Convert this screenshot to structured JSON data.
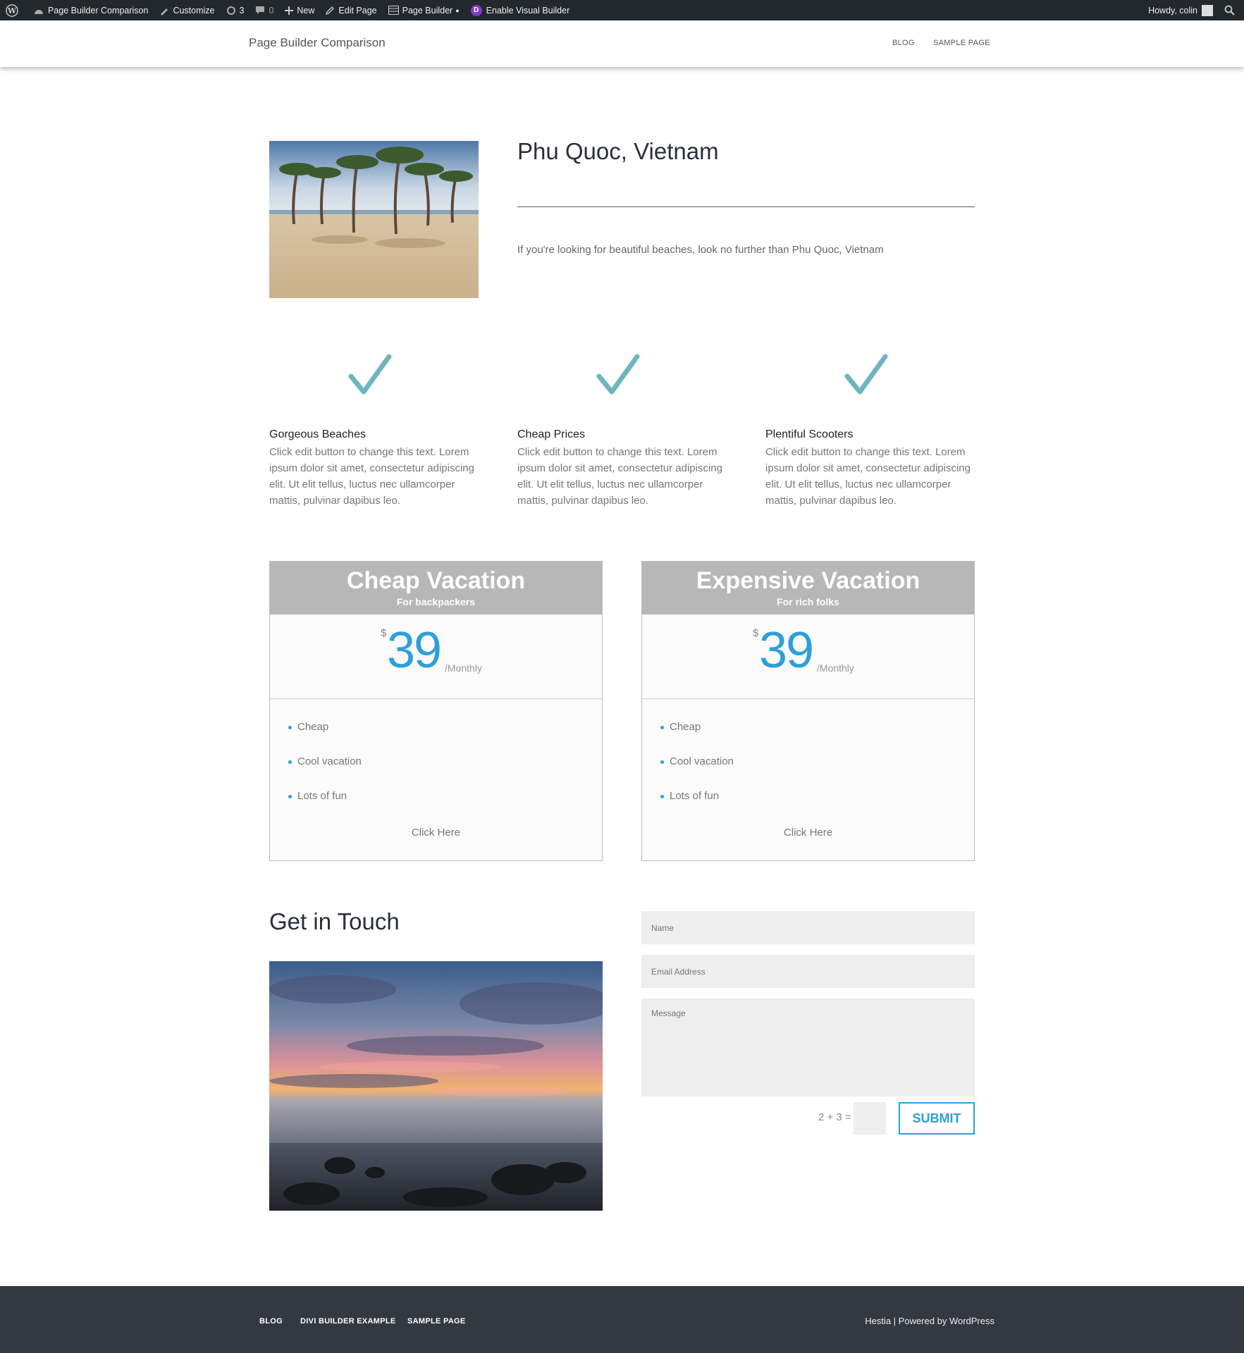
{
  "admin_bar": {
    "site_name": "Page Builder Comparison",
    "customize": "Customize",
    "updates_count": "3",
    "comments_count": "0",
    "new_label": "New",
    "edit_page": "Edit Page",
    "page_builder": "Page Builder",
    "visual_builder": "Enable Visual Builder",
    "divi_letter": "D",
    "greeting": "Howdy, colin"
  },
  "header": {
    "brand": "Page Builder Comparison",
    "nav": [
      "BLOG",
      "SAMPLE PAGE"
    ]
  },
  "intro": {
    "title": "Phu Quoc, Vietnam",
    "text": "If you're looking for beautiful beaches, look no further than Phu Quoc, Vietnam"
  },
  "features": [
    {
      "title": "Gorgeous Beaches",
      "text": "Click edit button to change this text. Lorem ipsum dolor sit amet, consectetur adipiscing elit. Ut elit tellus, luctus nec ullamcorper mattis, pulvinar dapibus leo.",
      "icon": "check-icon"
    },
    {
      "title": "Cheap Prices",
      "text": "Click edit button to change this text. Lorem ipsum dolor sit amet, consectetur adipiscing elit. Ut elit tellus, luctus nec ullamcorper mattis, pulvinar dapibus leo.",
      "icon": "check-icon"
    },
    {
      "title": "Plentiful Scooters",
      "text": "Click edit button to change this text. Lorem ipsum dolor sit amet, consectetur adipiscing elit. Ut elit tellus, luctus nec ullamcorper mattis, pulvinar dapibus leo.",
      "icon": "check-icon"
    }
  ],
  "pricing": [
    {
      "title": "Cheap Vacation",
      "subtitle": "For backpackers",
      "currency": "$",
      "price": "39",
      "period": "/Monthly",
      "items": [
        "Cheap",
        "Cool vacation",
        "Lots of fun"
      ],
      "button": "Click Here"
    },
    {
      "title": "Expensive Vacation",
      "subtitle": "For rich folks",
      "currency": "$",
      "price": "39",
      "period": "/Monthly",
      "items": [
        "Cheap",
        "Cool vacation",
        "Lots of fun"
      ],
      "button": "Click Here"
    }
  ],
  "contact": {
    "title": "Get in Touch",
    "name_placeholder": "Name",
    "email_placeholder": "Email Address",
    "message_placeholder": "Message",
    "captcha": "2 + 3 =",
    "submit": "SUBMIT"
  },
  "footer": {
    "links": [
      "BLOG",
      "DIVI BUILDER EXAMPLE",
      "SAMPLE PAGE"
    ],
    "credit_theme": "Hestia",
    "credit_sep": " | Powered by ",
    "credit_wp": "WordPress"
  },
  "colors": {
    "accent": "#2e9fdb",
    "check": "#6fb5bd",
    "admin_bar": "#23282d",
    "footer": "#343840",
    "pricing_header": "#b7b7b7"
  }
}
